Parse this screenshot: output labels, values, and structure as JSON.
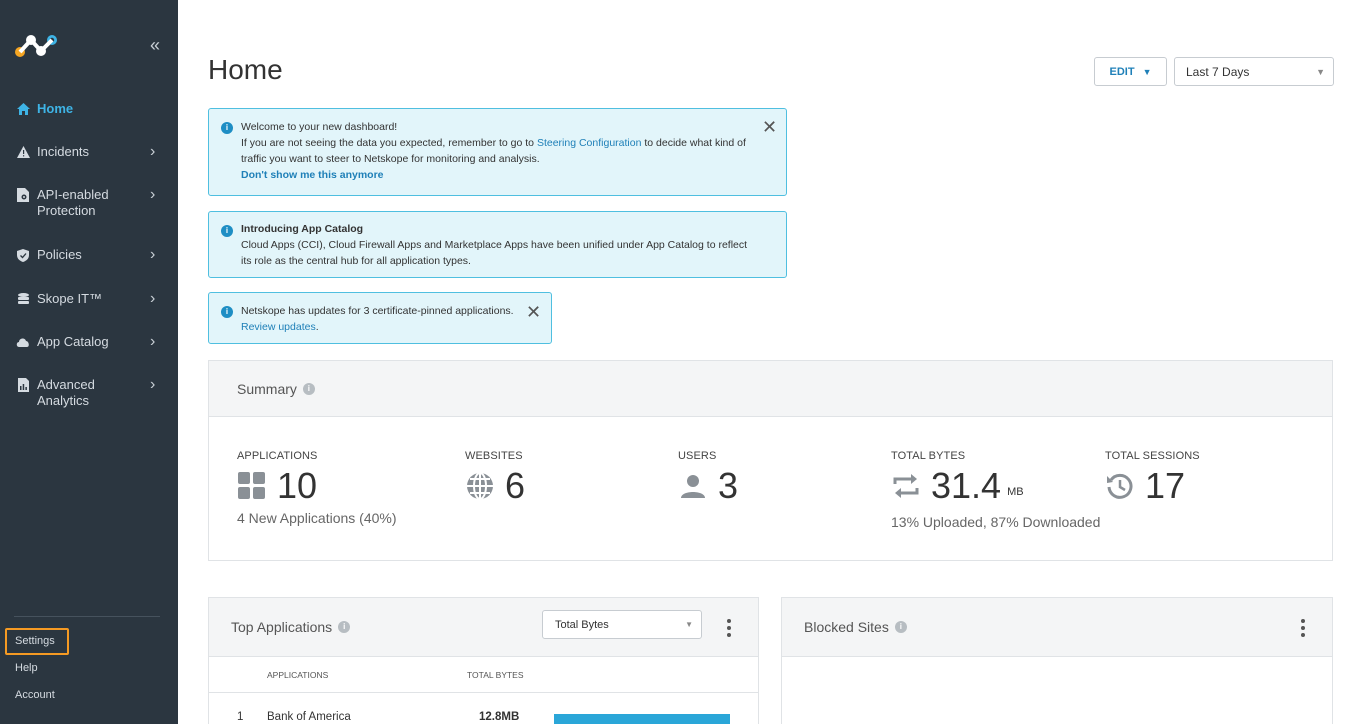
{
  "sidebar": {
    "items": [
      {
        "label": "Home",
        "icon": "home-icon",
        "active": true
      },
      {
        "label": "Incidents",
        "icon": "warning-icon"
      },
      {
        "label": "API-enabled Protection",
        "icon": "document-gear-icon"
      },
      {
        "label": "Policies",
        "icon": "shield-icon"
      },
      {
        "label": "Skope IT™",
        "icon": "database-icon"
      },
      {
        "label": "App Catalog",
        "icon": "cloud-icon"
      },
      {
        "label": "Advanced Analytics",
        "icon": "report-icon"
      }
    ],
    "bottom": {
      "settings": "Settings",
      "help": "Help",
      "account": "Account"
    }
  },
  "header": {
    "title": "Home",
    "edit_label": "EDIT",
    "range_value": "Last 7 Days"
  },
  "banners": {
    "welcome": {
      "line1": "Welcome to your new dashboard!",
      "line2_pre": "If you are not seeing the data you expected, remember to go to ",
      "line2_link": "Steering Configuration",
      "line2_post": " to decide what kind of",
      "line3": "traffic you want to steer to Netskope for monitoring and analysis.",
      "dismiss_link": "Don't show me this anymore"
    },
    "catalog": {
      "title": "Introducing App Catalog",
      "line1": "Cloud Apps (CCI), Cloud Firewall Apps and Marketplace Apps have been unified under App Catalog to reflect",
      "line2": "its role as the central hub for all application types."
    },
    "certs": {
      "line1": "Netskope has updates for 3 certificate-pinned applications.",
      "link": "Review updates",
      "link_suffix": "."
    }
  },
  "summary": {
    "title": "Summary",
    "applications": {
      "label": "APPLICATIONS",
      "value": "10",
      "sub": "4 New Applications (40%)"
    },
    "websites": {
      "label": "WEBSITES",
      "value": "6"
    },
    "users": {
      "label": "USERS",
      "value": "3"
    },
    "total_bytes": {
      "label": "TOTAL BYTES",
      "value": "31.4",
      "unit": "MB",
      "sub": "13% Uploaded, 87% Downloaded"
    },
    "total_sessions": {
      "label": "TOTAL SESSIONS",
      "value": "17"
    }
  },
  "top_apps": {
    "title": "Top Applications",
    "select_value": "Total Bytes",
    "columns": [
      "APPLICATIONS",
      "TOTAL BYTES"
    ],
    "rows": [
      {
        "rank": "1",
        "name": "Bank of America",
        "bytes": "12.8MB",
        "share": 1.0
      }
    ]
  },
  "blocked_sites": {
    "title": "Blocked Sites"
  },
  "colors": {
    "sidebar_bg": "#2b3640",
    "accent": "#3eb4e6",
    "banner_bg": "#e2f5fa",
    "banner_border": "#4fbfe0",
    "highlight": "#f59a23",
    "bar": "#2aa6d8"
  }
}
